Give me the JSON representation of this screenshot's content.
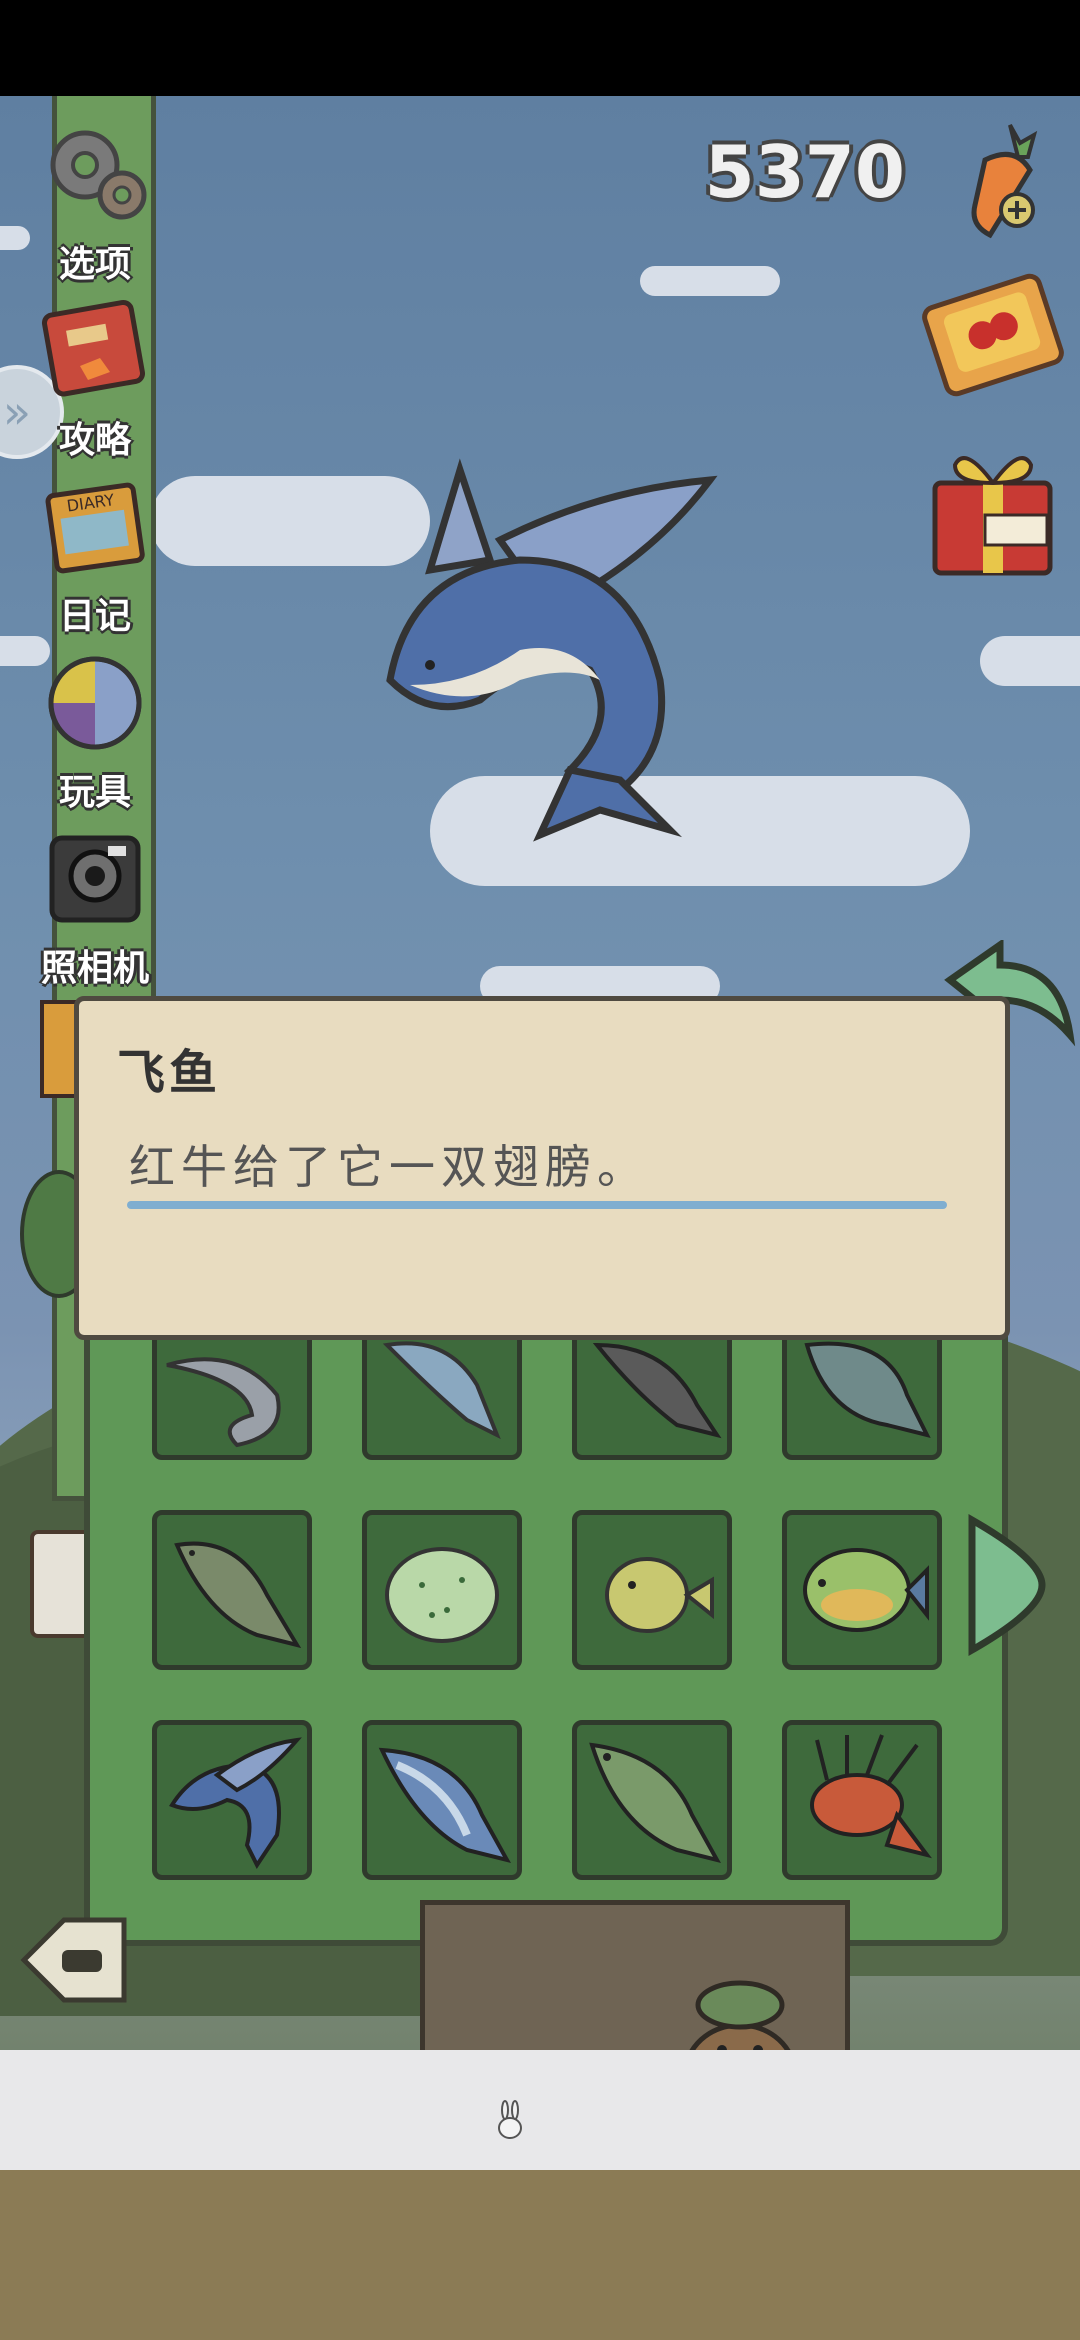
{
  "currency": {
    "carrots": "5370",
    "icon": "carrot-plus-icon"
  },
  "menu": [
    {
      "label": "选项",
      "icon": "gear-icon"
    },
    {
      "label": "攻略",
      "icon": "guide-book-icon"
    },
    {
      "label": "日记",
      "icon": "diary-icon"
    },
    {
      "label": "玩具",
      "icon": "toy-ball-icon"
    },
    {
      "label": "照相机",
      "icon": "camera-icon"
    }
  ],
  "dialog": {
    "title": "飞鱼",
    "description": "红牛给了它一双翅膀。"
  },
  "fish_grid": {
    "rows": [
      [
        "sturgeon",
        "blue-fish",
        "catfish",
        "tilapia"
      ],
      [
        "bass",
        "pufferfish",
        "small-puffer",
        "sunfish"
      ],
      [
        "flying-fish",
        "salmon",
        "largemouth-bass",
        "lionfish"
      ]
    ]
  },
  "colors": {
    "sky": "#6f8fae",
    "panel": "#5f9857",
    "dialog_bg": "#e8dcc0",
    "accent_line": "#7faed0"
  }
}
